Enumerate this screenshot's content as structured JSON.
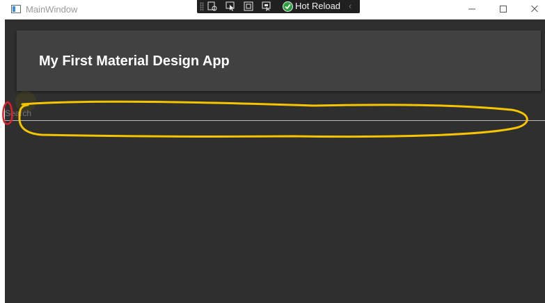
{
  "window": {
    "title": "MainWindow",
    "minimize_glyph": "—",
    "maximize_glyph": "☐",
    "close_glyph": "✕"
  },
  "debug_toolbar": {
    "hot_reload_label": "Hot Reload",
    "icons": [
      "live-visual-tree-icon",
      "select-element-icon",
      "display-layout-adorners-icon",
      "track-focus-icon",
      "hot-reload-status-icon"
    ],
    "hot_reload_status_color": "#2e9e3e"
  },
  "app_bar": {
    "title": "My First Material Design App",
    "background": "#414141"
  },
  "search": {
    "placeholder": "Search",
    "value": ""
  },
  "annotations": {
    "yellow_outline_color": "#f6c400",
    "red_outline_color": "#e0202a"
  },
  "colors": {
    "client_background": "#2f2f2f"
  }
}
